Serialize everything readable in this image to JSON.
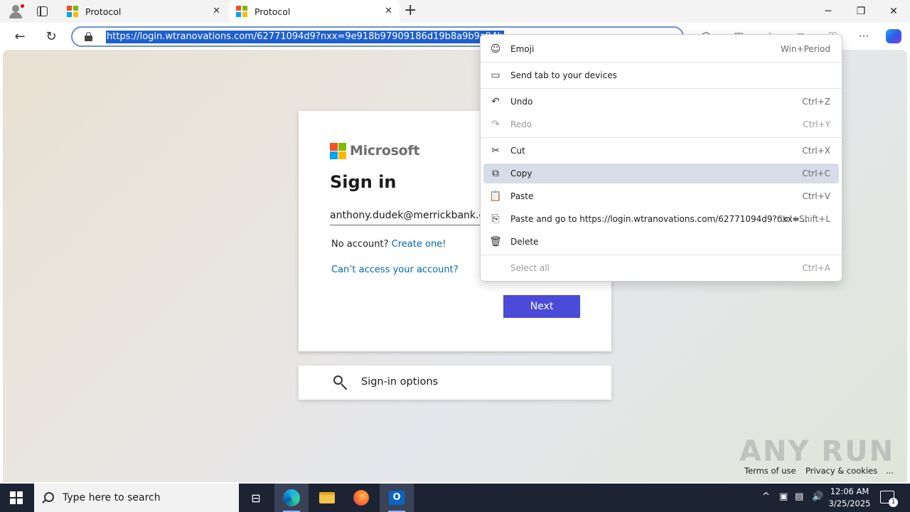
{
  "browser": {
    "tabs": [
      {
        "title": "Protocol",
        "active": false
      },
      {
        "title": "Protocol",
        "active": true
      }
    ],
    "address_bar": {
      "url": "https://login.wtranovations.com/62771094d9?nxx=9e918b97909186d19b8a9b9a94b",
      "selected": true
    }
  },
  "signin": {
    "brand": "Microsoft",
    "title": "Sign in",
    "email_value": "anthony.dudek@merrickbank.co",
    "no_account_text": "No account?",
    "create_link": "Create one!",
    "cant_access": "Can’t access your account?",
    "next_label": "Next",
    "options_label": "Sign-in options"
  },
  "footer": {
    "terms": "Terms of use",
    "privacy": "Privacy & cookies",
    "more": "..."
  },
  "watermark": "ANY RUN",
  "context_menu": {
    "items": [
      {
        "label": "Emoji",
        "shortcut": "Win+Period",
        "icon": "smiley-icon"
      },
      {
        "label": "Send tab to your devices",
        "shortcut": "",
        "icon": "devices-icon"
      },
      {
        "label": "Undo",
        "shortcut": "Ctrl+Z",
        "icon": "undo-icon"
      },
      {
        "label": "Redo",
        "shortcut": "Ctrl+Y",
        "icon": "redo-icon",
        "disabled": true
      },
      {
        "label": "Cut",
        "shortcut": "Ctrl+X",
        "icon": "scissors-icon"
      },
      {
        "label": "Copy",
        "shortcut": "Ctrl+C",
        "icon": "copy-icon",
        "hover": true
      },
      {
        "label": "Paste",
        "shortcut": "Ctrl+V",
        "icon": "paste-icon"
      },
      {
        "label": "Paste and go to https://login.wtranovations.com/62771094d9?nxx=...",
        "shortcut": "Ctrl+Shift+L",
        "icon": "paste-go-icon"
      },
      {
        "label": "Delete",
        "shortcut": "",
        "icon": "trash-icon"
      },
      {
        "label": "Select all",
        "shortcut": "Ctrl+A",
        "icon": "",
        "disabled": true
      }
    ]
  },
  "taskbar": {
    "search_placeholder": "Type here to search",
    "time": "12:06 AM",
    "date": "3/25/2025",
    "notification_count": "1"
  },
  "colors": {
    "accent_button": "#4a4bd8",
    "link": "#0067b8",
    "selection": "#1f5fd0",
    "taskbar": "#1c2333"
  }
}
